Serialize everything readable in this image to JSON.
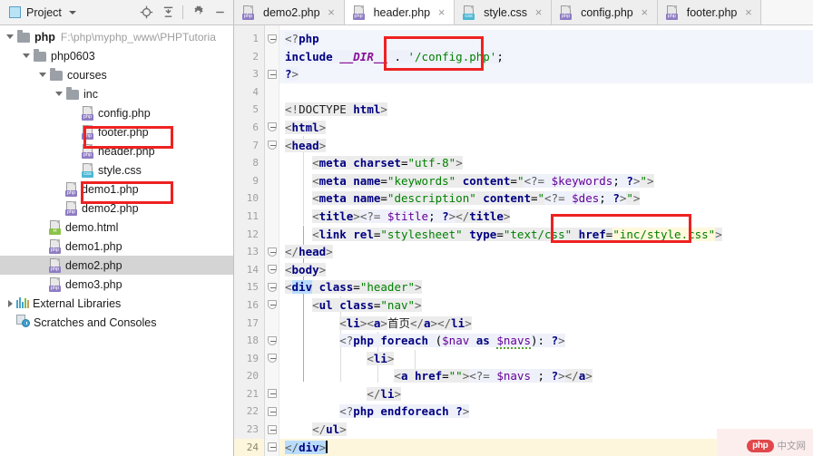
{
  "project_toolbar": {
    "title": "Project",
    "icons": [
      {
        "name": "locate-target-icon",
        "glyph": "locate"
      },
      {
        "name": "collapse-all-icon",
        "glyph": "collapse"
      },
      {
        "name": "gear-icon",
        "glyph": "gear"
      },
      {
        "name": "minimize-icon",
        "glyph": "minimize"
      }
    ]
  },
  "tabs": [
    {
      "label": "demo2.php",
      "icon": "php-file-icon",
      "badge": "php",
      "active": false,
      "close": "×"
    },
    {
      "label": "header.php",
      "icon": "php-file-icon",
      "badge": "php",
      "active": true,
      "close": "×"
    },
    {
      "label": "style.css",
      "icon": "css-file-icon",
      "badge": "css",
      "active": false,
      "close": "×"
    },
    {
      "label": "config.php",
      "icon": "php-file-icon",
      "badge": "php",
      "active": false,
      "close": "×"
    },
    {
      "label": "footer.php",
      "icon": "php-file-icon",
      "badge": "php",
      "active": false,
      "close": "×"
    }
  ],
  "tree": {
    "root_label": "php",
    "root_path": "F:\\php\\myphp_www\\PHPTutoria",
    "nodes": [
      {
        "label": "php",
        "path": "F:\\php\\myphp_www\\PHPTutoria",
        "depth": 0,
        "arrow": "down",
        "icon": "folder-icon",
        "badge": "",
        "bold": true,
        "selected": false
      },
      {
        "label": "php0603",
        "path": "",
        "depth": 1,
        "arrow": "down",
        "icon": "folder-icon",
        "badge": "",
        "bold": false,
        "selected": false
      },
      {
        "label": "courses",
        "path": "",
        "depth": 2,
        "arrow": "down",
        "icon": "folder-icon",
        "badge": "",
        "bold": false,
        "selected": false
      },
      {
        "label": "inc",
        "path": "",
        "depth": 3,
        "arrow": "down",
        "icon": "folder-icon",
        "badge": "",
        "bold": false,
        "selected": false
      },
      {
        "label": "config.php",
        "path": "",
        "depth": 4,
        "arrow": "none",
        "icon": "php-file-icon",
        "badge": "php",
        "bold": false,
        "selected": false
      },
      {
        "label": "footer.php",
        "path": "",
        "depth": 4,
        "arrow": "none",
        "icon": "php-file-icon",
        "badge": "php",
        "bold": false,
        "selected": false
      },
      {
        "label": "header.php",
        "path": "",
        "depth": 4,
        "arrow": "none",
        "icon": "php-file-icon",
        "badge": "php",
        "bold": false,
        "selected": false
      },
      {
        "label": "style.css",
        "path": "",
        "depth": 4,
        "arrow": "none",
        "icon": "css-file-icon",
        "badge": "css",
        "bold": false,
        "selected": false
      },
      {
        "label": "demo1.php",
        "path": "",
        "depth": 3,
        "arrow": "none",
        "icon": "php-file-icon",
        "badge": "php",
        "bold": false,
        "selected": false
      },
      {
        "label": "demo2.php",
        "path": "",
        "depth": 3,
        "arrow": "none",
        "icon": "php-file-icon",
        "badge": "php",
        "bold": false,
        "selected": false
      },
      {
        "label": "demo.html",
        "path": "",
        "depth": 2,
        "arrow": "none",
        "icon": "html-file-icon",
        "badge": "H",
        "bold": false,
        "selected": false
      },
      {
        "label": "demo1.php",
        "path": "",
        "depth": 2,
        "arrow": "none",
        "icon": "php-file-icon",
        "badge": "php",
        "bold": false,
        "selected": false
      },
      {
        "label": "demo2.php",
        "path": "",
        "depth": 2,
        "arrow": "none",
        "icon": "php-file-icon",
        "badge": "php",
        "bold": false,
        "selected": true
      },
      {
        "label": "demo3.php",
        "path": "",
        "depth": 2,
        "arrow": "none",
        "icon": "php-file-icon",
        "badge": "php",
        "bold": false,
        "selected": false
      },
      {
        "label": "External Libraries",
        "path": "",
        "depth": 0,
        "arrow": "right",
        "icon": "libraries-icon",
        "badge": "",
        "bold": false,
        "selected": false
      },
      {
        "label": "Scratches and Consoles",
        "path": "",
        "depth": 0,
        "arrow": "none",
        "icon": "scratches-icon",
        "badge": "",
        "bold": false,
        "selected": false
      }
    ]
  },
  "editor": {
    "line_numbers": [
      1,
      2,
      3,
      4,
      5,
      6,
      7,
      8,
      9,
      10,
      11,
      12,
      13,
      14,
      15,
      16,
      17,
      18,
      19,
      20,
      21,
      22,
      23,
      24
    ],
    "current_line": 24,
    "lines": [
      {
        "n": 1,
        "text": "<?php"
      },
      {
        "n": 2,
        "text": "include __DIR__ . '/config.php';"
      },
      {
        "n": 3,
        "text": "?>"
      },
      {
        "n": 4,
        "text": ""
      },
      {
        "n": 5,
        "text": "<!DOCTYPE html>"
      },
      {
        "n": 6,
        "text": "<html>"
      },
      {
        "n": 7,
        "text": "<head>"
      },
      {
        "n": 8,
        "text": "    <meta charset=\"utf-8\">"
      },
      {
        "n": 9,
        "text": "    <meta name=\"keywords\" content=\"<?= $keywords; ?>\">"
      },
      {
        "n": 10,
        "text": "    <meta name=\"description\" content=\"<?= $des; ?>\">"
      },
      {
        "n": 11,
        "text": "    <title><?= $title; ?></title>"
      },
      {
        "n": 12,
        "text": "    <link rel=\"stylesheet\" type=\"text/css\" href=\"inc/style.css\">"
      },
      {
        "n": 13,
        "text": "</head>"
      },
      {
        "n": 14,
        "text": "<body>"
      },
      {
        "n": 15,
        "text": "<div class=\"header\">"
      },
      {
        "n": 16,
        "text": "    <ul class=\"nav\">"
      },
      {
        "n": 17,
        "text": "        <li><a>首页</a></li>"
      },
      {
        "n": 18,
        "text": "        <?php foreach ($nav as $navs): ?>"
      },
      {
        "n": 19,
        "text": "            <li>"
      },
      {
        "n": 20,
        "text": "                <a href=\"\"><?= $navs ; ?></a>"
      },
      {
        "n": 21,
        "text": "            </li>"
      },
      {
        "n": 22,
        "text": "        <?php endforeach ?>"
      },
      {
        "n": 23,
        "text": "    </ul>"
      },
      {
        "n": 24,
        "text": "</div>"
      }
    ]
  },
  "annotations": [
    {
      "name": "annotation-config-include",
      "note": "'/config.php'"
    },
    {
      "name": "annotation-tree-config-php",
      "note": "config.php"
    },
    {
      "name": "annotation-tree-style-css",
      "note": "style.css"
    },
    {
      "name": "annotation-href-style-css",
      "note": "href=\"inc/style.css\""
    }
  ],
  "watermark": {
    "brand": "php",
    "suffix": "中文网"
  },
  "colors": {
    "annotation": "#ee2222",
    "selection": "#d4d4d4",
    "current_line": "#fdf6dd",
    "tag": "#000080",
    "string": "#008000",
    "variable": "#660099"
  }
}
